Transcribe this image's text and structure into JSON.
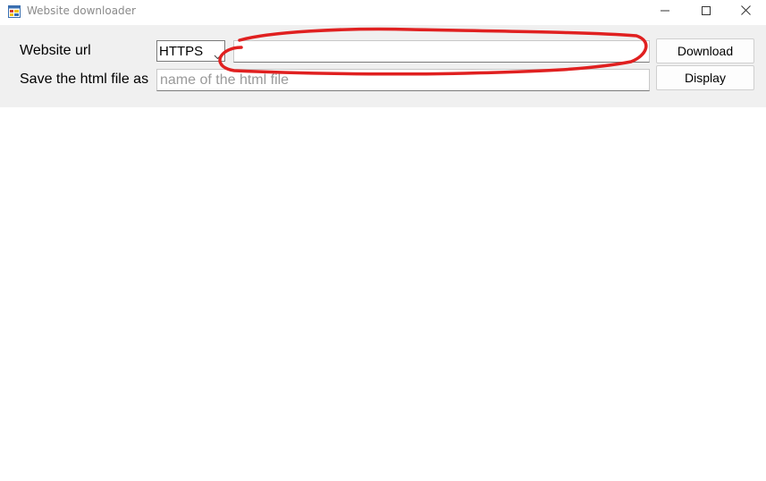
{
  "window": {
    "title": "Website downloader"
  },
  "form": {
    "url_label": "Website url",
    "protocol_selected": "HTTPS",
    "url_value": "",
    "save_label": "Save the html file as",
    "filename_placeholder": "name of the html file",
    "filename_value": ""
  },
  "buttons": {
    "download_label": "Download",
    "display_label": "Display"
  },
  "annotation": {
    "color": "#e02020"
  },
  "icons": {
    "app": "app-window-icon",
    "minimize": "minimize-icon",
    "maximize": "maximize-icon",
    "close": "close-icon",
    "dropdown": "chevron-down-icon"
  }
}
